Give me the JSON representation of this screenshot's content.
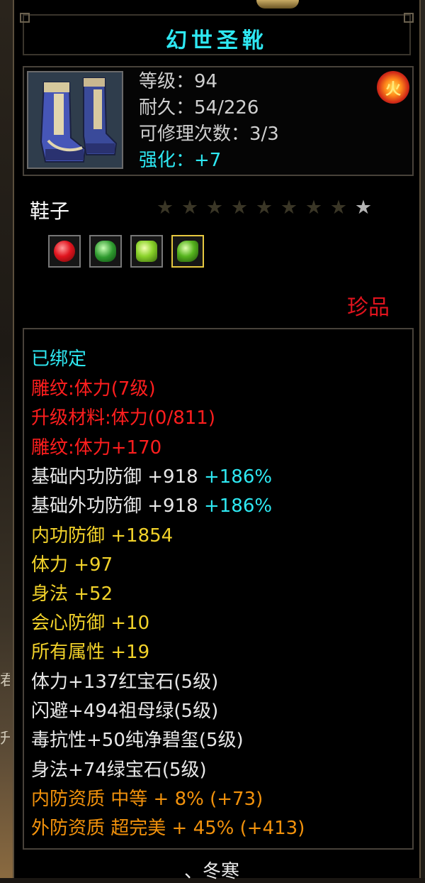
{
  "item": {
    "name": "幻世圣靴",
    "level_label": "等级：94",
    "durability_label": "耐久：54/226",
    "repair_label": "可修理次数：3/3",
    "enhance_label": "强化：+7"
  },
  "type_label": "鞋子",
  "stars": {
    "total": 9,
    "lit": 1
  },
  "gems": [
    {
      "icon": "ruby-gem-icon"
    },
    {
      "icon": "emerald-gem-icon"
    },
    {
      "icon": "jade-gem-icon"
    },
    {
      "icon": "green-gem-icon",
      "selected": true
    }
  ],
  "rarity": "珍品",
  "details": {
    "bound": "已绑定",
    "engrave": "雕纹:体力(7级)",
    "upgrade_material": "升级材料:体力(0/811)",
    "engrave_bonus": "雕纹:体力+170",
    "base_inner_def": {
      "label": "基础内功防御 +918",
      "pct": "+186%"
    },
    "base_outer_def": {
      "label": "基础外功防御 +918",
      "pct": "+186%"
    },
    "inner_def": "内功防御 +1854",
    "stamina": "体力 +97",
    "agility": "身法 +52",
    "crit_def": "会心防御 +10",
    "all_attr": "所有属性 +19",
    "gem_line_1": "体力+137红宝石(5级)",
    "gem_line_2": "闪避+494祖母绿(5级)",
    "gem_line_3": "毒抗性+50纯净碧玺(5级)",
    "gem_line_4": "身法+74绿宝石(5级)",
    "inner_quality": "内防资质 中等 + 8% (+73)",
    "outer_quality": "外防资质 超完美 + 45% (+413)"
  },
  "footer_text": "、冬寒",
  "background_glyphs": [
    "君",
    "升"
  ],
  "colors": {
    "title": "#2ee8f2",
    "rarity": "#e0141e",
    "engrave": "#ff1e1e",
    "attr": "#f2d22a",
    "quality": "#f2920c"
  }
}
